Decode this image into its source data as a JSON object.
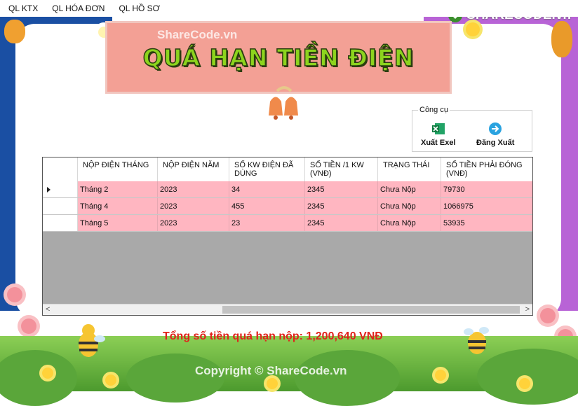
{
  "menu": [
    "QL KTX",
    "QL HÓA ĐƠN",
    "QL HỒ SƠ"
  ],
  "watermark": "ShareCode.vn",
  "logo_text": "SHARECODE.vn",
  "title": "QUÁ HẠN TIỀN ĐIỆN",
  "tools": {
    "group_label": "Công cụ",
    "export_label": "Xuất Exel",
    "logout_label": "Đăng Xuất"
  },
  "table": {
    "columns": [
      "NỘP ĐIỆN THÁNG",
      "NỘP ĐIỆN NĂM",
      "SỐ KW ĐIỆN ĐÃ DÙNG",
      "SỐ TIỀN /1 KW (VNĐ)",
      "TRẠNG THÁI",
      "SỐ TIỀN PHẢI ĐÓNG (VNĐ)"
    ],
    "rows": [
      [
        "Tháng 2",
        "2023",
        "34",
        "2345",
        "Chưa Nộp",
        "79730"
      ],
      [
        "Tháng 4",
        "2023",
        "455",
        "2345",
        "Chưa Nộp",
        "1066975"
      ],
      [
        "Tháng 5",
        "2023",
        "23",
        "2345",
        "Chưa Nộp",
        "53935"
      ]
    ]
  },
  "total_label": "Tổng số tiền quá hạn nộp: 1,200,640 VNĐ",
  "copyright": "Copyright © ShareCode.vn",
  "colors": {
    "row_bg": "#ffb6c1",
    "banner_bg": "#f3a095",
    "title_text": "#8cd41e",
    "total_text": "#e0231c",
    "grid_empty": "#a9a9a9"
  }
}
